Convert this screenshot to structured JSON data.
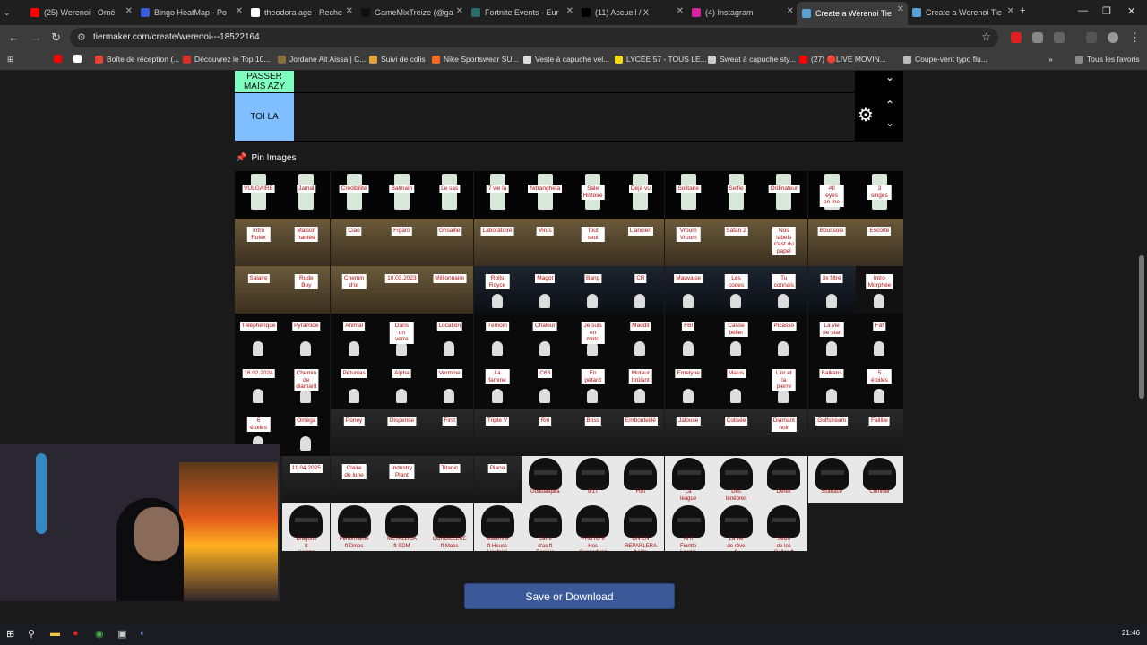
{
  "browser": {
    "tabs": [
      {
        "label": "(25) Werenoi - Omé",
        "color": "#ff0000"
      },
      {
        "label": "Bingo HeatMap - Po",
        "color": "#3b5cd8"
      },
      {
        "label": "theodora age - Reche",
        "color": "#ffffff"
      },
      {
        "label": "GameMixTreize (@ga",
        "color": "#111111"
      },
      {
        "label": "Fortnite Events - Eur",
        "color": "#2d6a6a"
      },
      {
        "label": "(11) Accueil / X",
        "color": "#000000"
      },
      {
        "label": "(4) Instagram",
        "color": "#d6249f"
      },
      {
        "label": "Create a Werenoi Tie",
        "color": "#5aa1d6"
      },
      {
        "label": "Create a Werenoi Tie",
        "color": "#5aa1d6"
      }
    ],
    "url": "tiermaker.com/create/werenoi---18522164",
    "bookmarks": [
      {
        "label": "",
        "color": "#ff0000"
      },
      {
        "label": "",
        "color": "#ffffff"
      },
      {
        "label": "Boîte de réception (...",
        "color": "#e94235"
      },
      {
        "label": "Découvrez le Top 10...",
        "color": "#d93025"
      },
      {
        "label": "Jordane Ait Aissa | C...",
        "color": "#8a6d3b"
      },
      {
        "label": "Suivi de colis",
        "color": "#e0a43a"
      },
      {
        "label": "Nike Sportswear SU...",
        "color": "#f26b21"
      },
      {
        "label": "Veste à capuche vel...",
        "color": "#dddddd"
      },
      {
        "label": "LYCÉE 57 - TOUS LE...",
        "color": "#f5d90a"
      },
      {
        "label": "Sweat à capuche sty...",
        "color": "#cccccc"
      },
      {
        "label": "(27) 🔴LIVE MOVIN...",
        "color": "#ff0000"
      },
      {
        "label": "Coupe-vent typo flu...",
        "color": "#bbbbbb"
      }
    ],
    "all_bookmarks": "Tous les favoris"
  },
  "tiers": [
    {
      "label": "PASSER MAIS AZY",
      "color": "#7fffbf"
    },
    {
      "label": "TOI LA",
      "color": "#7fbfff"
    }
  ],
  "pin_header": "Pin Images",
  "grid": {
    "rows": [
      {
        "style": "phone",
        "items": [
          "VULGAIRE",
          "Jamal",
          "Crédibilité",
          "Balmain",
          "Le sas",
          "7 vie la",
          "Ndrangheta",
          "Sale Histoire",
          "Déjà vu",
          "Solitaire",
          "Selfie",
          "Ordinateur",
          "All eyes on me",
          "3 singes"
        ]
      },
      {
        "style": "gold",
        "items": [
          "Intro Rolex",
          "Maison hantée",
          "Ciao",
          "Figaro",
          "Grisaille",
          "Laboratoire",
          "Virus",
          "Tout seul",
          "L'ancien",
          "Vroum Vroum",
          "Satan 2",
          "Nos labels c'est du papel",
          "Boussole",
          "Escorte"
        ]
      },
      {
        "style": "mixed3",
        "items": [
          "Salaire",
          "Rude Boy",
          "Chemin d'or",
          "10.03.2023",
          "Millionnaire",
          "Rolls Royce",
          "Magot",
          "Bang",
          "CR",
          "Mauvaise",
          "Les codes",
          "Tu connais",
          "3x filtré",
          "Intro Morphée"
        ]
      },
      {
        "style": "dark",
        "items": [
          "Téléphérique",
          "Pyramide",
          "Animal",
          "Dans un verre",
          "Location",
          "Témoin",
          "Chaleur",
          "Je suis en moto",
          "Maudit",
          "FBI",
          "Casse bélier",
          "Picasso",
          "La vie de star",
          "Faf"
        ]
      },
      {
        "style": "dark",
        "items": [
          "16.02.2024",
          "Chemin de diamant",
          "Pétunias",
          "Alpha",
          "Vermine",
          "La famine",
          "C63",
          "En pétard",
          "Moteur brûlant",
          "Emelyne",
          "Malus",
          "L'or et la pierre",
          "Balkans",
          "5 étoiles"
        ]
      },
      {
        "style": "mixed6",
        "items": [
          "6 étoiles",
          "Oméga",
          "Poney",
          "Dispense",
          "First",
          "Triple V",
          "Riri",
          "Boss",
          "Embouteillé",
          "Jalouse",
          "Colisée",
          "Diamant noir",
          "Gulfstream",
          "Faillite"
        ]
      },
      {
        "style": "mixed7",
        "items": [
          "",
          "11.04.2025",
          "Claire de lune",
          "Industry Plant",
          "Titanic",
          "Piano",
          "Guadalajara",
          "9.17",
          "Fort",
          "La league",
          "Des ténèbres",
          "Derek",
          "Scarface",
          "Criminel"
        ]
      },
      {
        "style": "portrait",
        "items": [
          "",
          "Dragons ft Hamza",
          "Performante ft Dinos",
          "METALLICA ft SDM",
          "CORDILLERE ft Maes",
          "Malarrine ft Heuss L'enfoiré",
          "Carré d'as ft Ronisia",
          "PHOTO ft Hos Copperfield",
          "ON EN REPARLERA ft Hits Copperfield",
          "Al ft Fioritto Lacrim Mac Tyer",
          "La vie de rêve ft Dosseh",
          "Seize de los Gallos ft L'ader encore",
          "",
          ""
        ]
      }
    ]
  },
  "save_button": "Save or Download",
  "taskbar": {
    "time": "21:46"
  }
}
